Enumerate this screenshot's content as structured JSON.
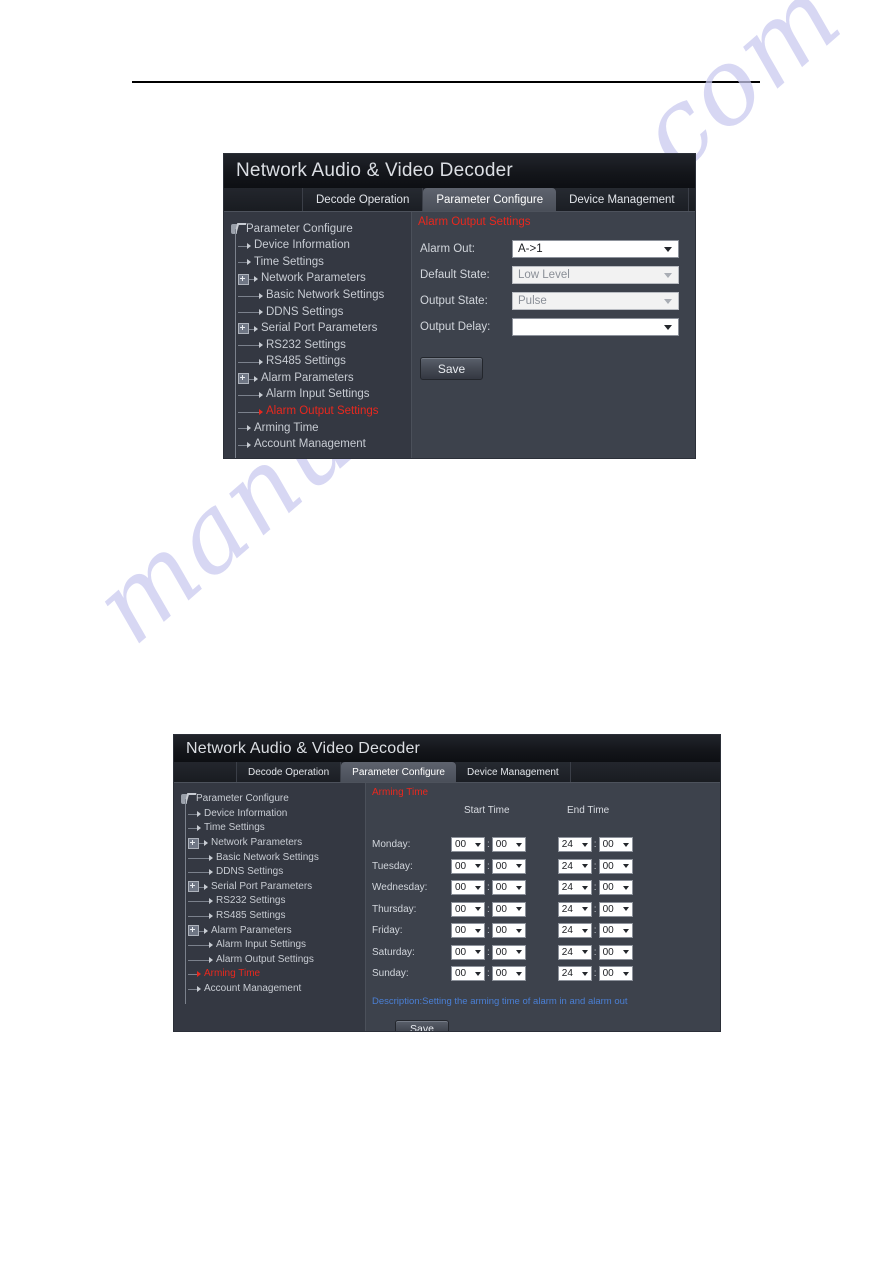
{
  "watermark": {
    "text": "manualshive.com"
  },
  "app": {
    "title": "Network Audio & Video Decoder",
    "tabs": [
      {
        "label": "Decode Operation",
        "active": false
      },
      {
        "label": "Parameter Configure",
        "active": true
      },
      {
        "label": "Device Management",
        "active": false
      }
    ]
  },
  "tree": {
    "root": "Parameter Configure",
    "items": [
      {
        "label": "Device Information",
        "level": 1,
        "expander": "none"
      },
      {
        "label": "Time Settings",
        "level": 1,
        "expander": "none"
      },
      {
        "label": "Network Parameters",
        "level": 1,
        "expander": "plus"
      },
      {
        "label": "Basic Network Settings",
        "level": 2,
        "expander": "none"
      },
      {
        "label": "DDNS Settings",
        "level": 2,
        "expander": "none"
      },
      {
        "label": "Serial Port Parameters",
        "level": 1,
        "expander": "plus"
      },
      {
        "label": "RS232 Settings",
        "level": 2,
        "expander": "none"
      },
      {
        "label": "RS485 Settings",
        "level": 2,
        "expander": "none"
      },
      {
        "label": "Alarm Parameters",
        "level": 1,
        "expander": "plus"
      },
      {
        "label": "Alarm Input Settings",
        "level": 2,
        "expander": "none"
      },
      {
        "label": "Alarm Output Settings",
        "level": 2,
        "expander": "none"
      },
      {
        "label": "Arming Time",
        "level": 1,
        "expander": "none"
      },
      {
        "label": "Account Management",
        "level": 1,
        "expander": "none"
      }
    ]
  },
  "screen1": {
    "selected_tree_label": "Alarm Output Settings",
    "section_title": "Alarm Output Settings",
    "fields": [
      {
        "label": "Alarm Out:",
        "value": "A->1",
        "disabled": false
      },
      {
        "label": "Default State:",
        "value": "Low Level",
        "disabled": true
      },
      {
        "label": "Output State:",
        "value": "Pulse",
        "disabled": true
      },
      {
        "label": "Output Delay:",
        "value": "",
        "disabled": false
      }
    ],
    "save_label": "Save"
  },
  "screen2": {
    "selected_tree_label": "Arming Time",
    "section_title": "Arming Time",
    "columns": {
      "start": "Start Time",
      "end": "End Time"
    },
    "rows": [
      {
        "day": "Monday:",
        "start_h": "00",
        "start_m": "00",
        "end_h": "24",
        "end_m": "00"
      },
      {
        "day": "Tuesday:",
        "start_h": "00",
        "start_m": "00",
        "end_h": "24",
        "end_m": "00"
      },
      {
        "day": "Wednesday:",
        "start_h": "00",
        "start_m": "00",
        "end_h": "24",
        "end_m": "00"
      },
      {
        "day": "Thursday:",
        "start_h": "00",
        "start_m": "00",
        "end_h": "24",
        "end_m": "00"
      },
      {
        "day": "Friday:",
        "start_h": "00",
        "start_m": "00",
        "end_h": "24",
        "end_m": "00"
      },
      {
        "day": "Saturday:",
        "start_h": "00",
        "start_m": "00",
        "end_h": "24",
        "end_m": "00"
      },
      {
        "day": "Sunday:",
        "start_h": "00",
        "start_m": "00",
        "end_h": "24",
        "end_m": "00"
      }
    ],
    "time_separator": ":",
    "description": "Description:Setting the arming time of alarm in and alarm out",
    "save_label": "Save"
  }
}
